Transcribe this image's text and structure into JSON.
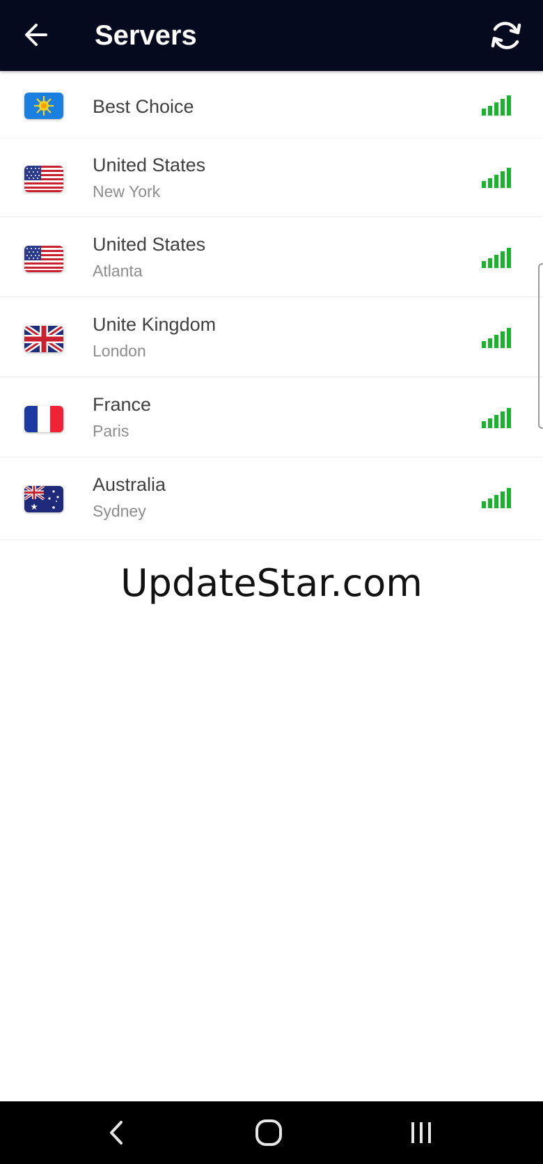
{
  "header": {
    "title": "Servers",
    "back_icon": "arrow-left-icon",
    "refresh_icon": "refresh-icon",
    "background": "#050a1e"
  },
  "servers": [
    {
      "name": "Best Choice",
      "city": "",
      "flag_icon": "sun-flag-icon",
      "signal_bars": 5
    },
    {
      "name": "United States",
      "city": "New York",
      "flag_icon": "us-flag-icon",
      "signal_bars": 5
    },
    {
      "name": "United States",
      "city": "Atlanta",
      "flag_icon": "us-flag-icon",
      "signal_bars": 5
    },
    {
      "name": "Unite Kingdom",
      "city": "London",
      "flag_icon": "uk-flag-icon",
      "signal_bars": 5
    },
    {
      "name": "France",
      "city": "Paris",
      "flag_icon": "fr-flag-icon",
      "signal_bars": 5
    },
    {
      "name": "Australia",
      "city": "Sydney",
      "flag_icon": "au-flag-icon",
      "signal_bars": 5
    }
  ],
  "signal_color": "#19b32c",
  "watermark": "UpdateStar.com",
  "system_nav": {
    "back_icon": "nav-back-icon",
    "home_icon": "nav-home-icon",
    "recents_icon": "nav-recents-icon"
  }
}
